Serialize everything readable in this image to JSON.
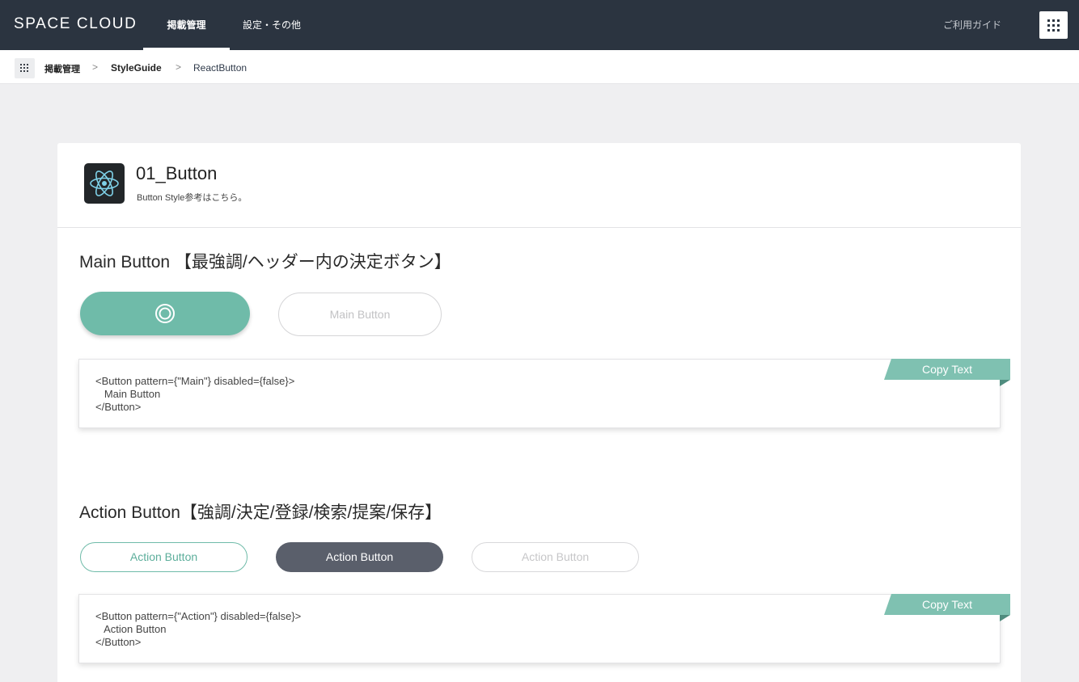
{
  "header": {
    "brand": "SPACE CLOUD",
    "tabs": [
      {
        "label": "掲載管理"
      },
      {
        "label": "設定・その他"
      }
    ],
    "guide_label": "ご利用ガイド"
  },
  "breadcrumb": {
    "items": [
      "掲載管理",
      "StyleGuide",
      "ReactButton"
    ],
    "separator": ">"
  },
  "card": {
    "title": "01_Button",
    "subtitle": "Button Style参考はこちら。"
  },
  "sections": [
    {
      "title": "Main Button 【最強調/ヘッダー内の決定ボタン】",
      "buttons": {
        "disabled_label": "Main Button"
      },
      "code": "<Button pattern={\"Main\"} disabled={false}>\n   Main Button\n</Button>",
      "copy_label": "Copy Text"
    },
    {
      "title": "Action Button【強調/決定/登録/検索/提案/保存】",
      "buttons": {
        "outline_label": "Action Button",
        "filled_label": "Action Button",
        "disabled_label": "Action Button"
      },
      "code": "<Button pattern={\"Action\"} disabled={false}>\n   Action Button\n</Button>",
      "copy_label": "Copy Text"
    }
  ],
  "colors": {
    "header_bg": "#2b3440",
    "accent": "#6fbba9",
    "action_filled": "#5a5f6b",
    "page_bg": "#efeff1"
  },
  "icons": {
    "menu": "grid-icon",
    "logo": "react-logo-icon",
    "loading": "loading-spinner-icon"
  }
}
